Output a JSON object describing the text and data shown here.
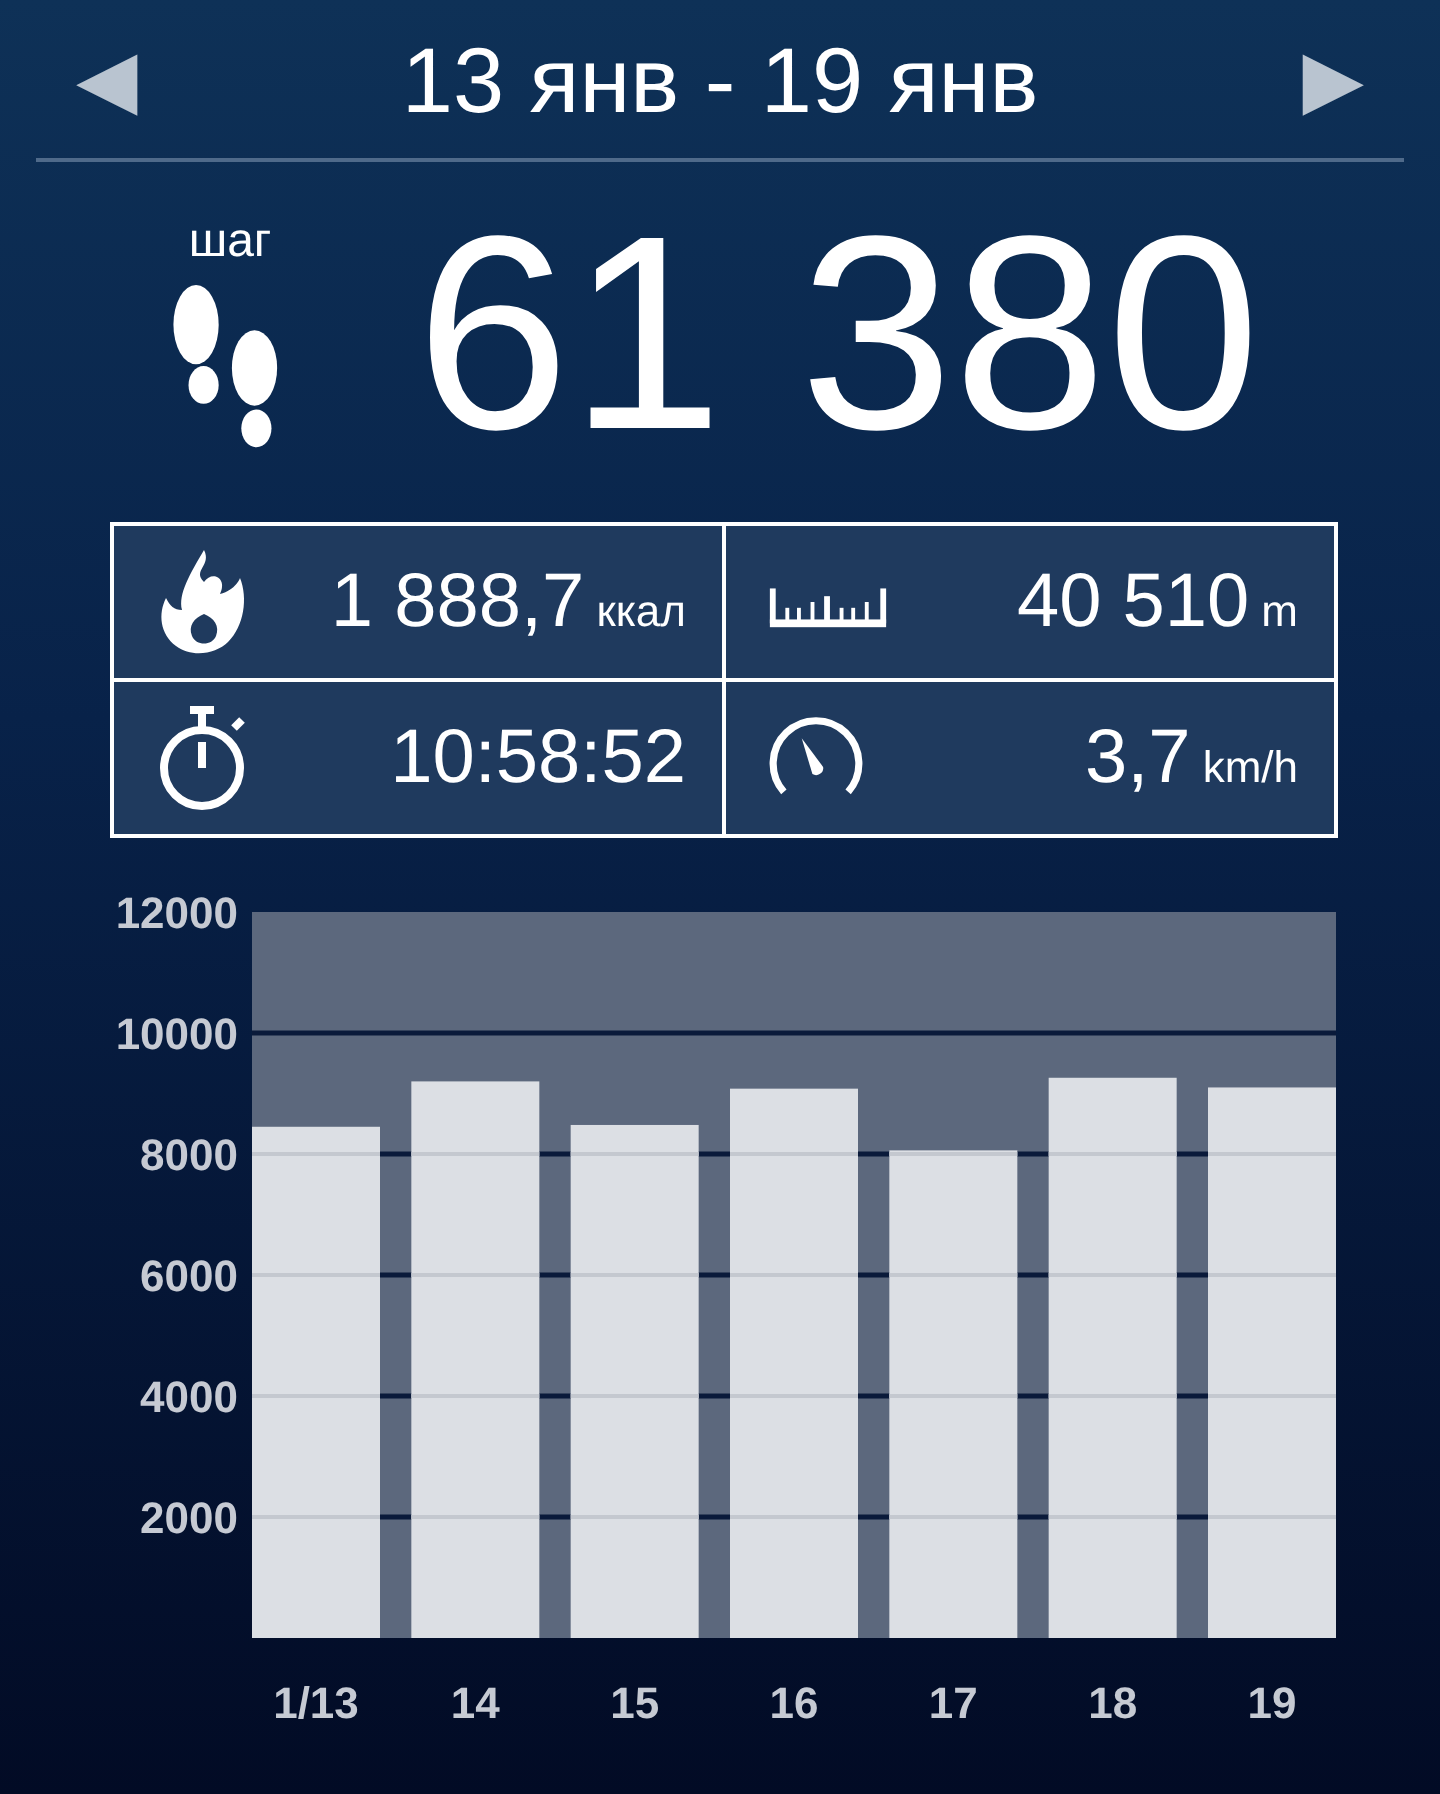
{
  "header": {
    "prev": "◀",
    "title": "13 янв - 19 янв",
    "next": "▶"
  },
  "steps": {
    "label": "шаг",
    "value": "61 380"
  },
  "stats": [
    {
      "kind": "calories",
      "value": "1 888,7",
      "unit": "ккал"
    },
    {
      "kind": "distance",
      "value": "40 510",
      "unit": "m"
    },
    {
      "kind": "duration",
      "value": "10:58:52"
    },
    {
      "kind": "speed",
      "value": "3,7",
      "unit": "km/h"
    }
  ],
  "chart": {
    "chart_data": {
      "type": "bar",
      "categories": [
        "1/13",
        "14",
        "15",
        "16",
        "17",
        "18",
        "19"
      ],
      "series": [
        {
          "color": "#dcdfe4",
          "values": [
            8450,
            9200,
            8480,
            9080,
            8060,
            9260,
            9100
          ]
        }
      ],
      "ylim": [
        0,
        12000
      ],
      "yticks": [
        2000,
        4000,
        6000,
        8000,
        10000,
        12000
      ],
      "grid": true
    }
  }
}
